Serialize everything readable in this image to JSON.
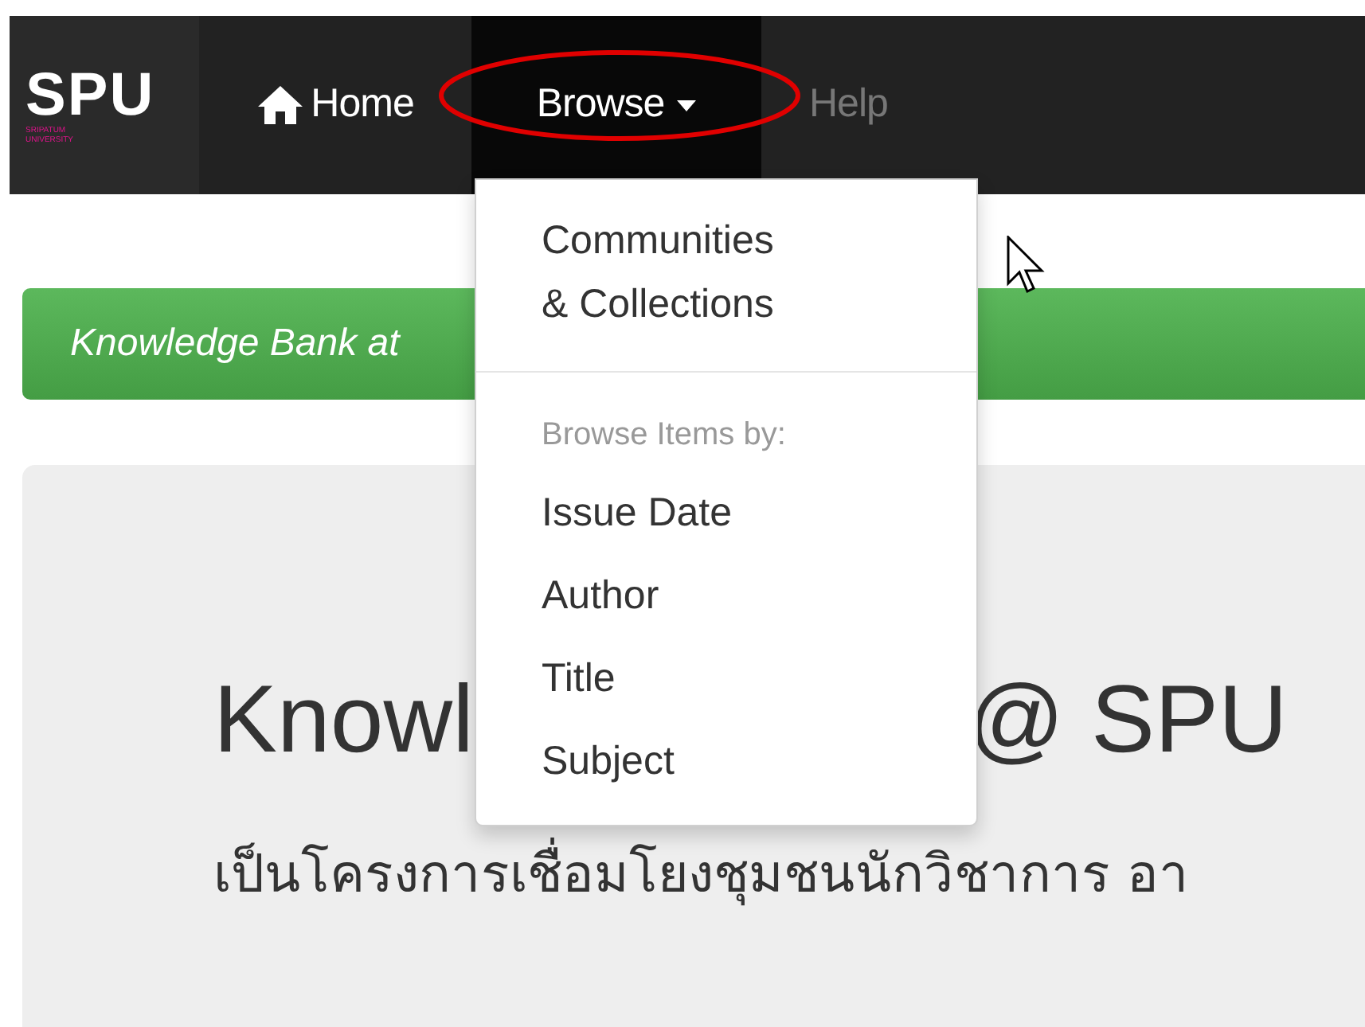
{
  "navbar": {
    "logo": {
      "text": "SPU",
      "subtext": "SRIPATUM UNIVERSITY"
    },
    "items": [
      {
        "label": "Home",
        "kind": "home",
        "selected": false
      },
      {
        "label": "Browse",
        "kind": "dropdown",
        "selected": true,
        "expanded": true
      },
      {
        "label": "Help",
        "kind": "disabled",
        "selected": false
      }
    ]
  },
  "dropdown": {
    "items": [
      {
        "kind": "link",
        "label": "Communities\n& Collections"
      },
      {
        "kind": "divider"
      },
      {
        "kind": "header",
        "label": "Browse Items by:"
      },
      {
        "kind": "link",
        "label": "Issue Date"
      },
      {
        "kind": "link",
        "label": "Author"
      },
      {
        "kind": "link",
        "label": "Title"
      },
      {
        "kind": "link",
        "label": "Subject"
      }
    ]
  },
  "banner": {
    "text": "Knowledge Bank at"
  },
  "jumbotron": {
    "heading_start": "Knowl",
    "heading_end": "@ SPU",
    "text": "เป็นโครงการเชื่อมโยงชุมชนนักวิชาการ อา"
  }
}
